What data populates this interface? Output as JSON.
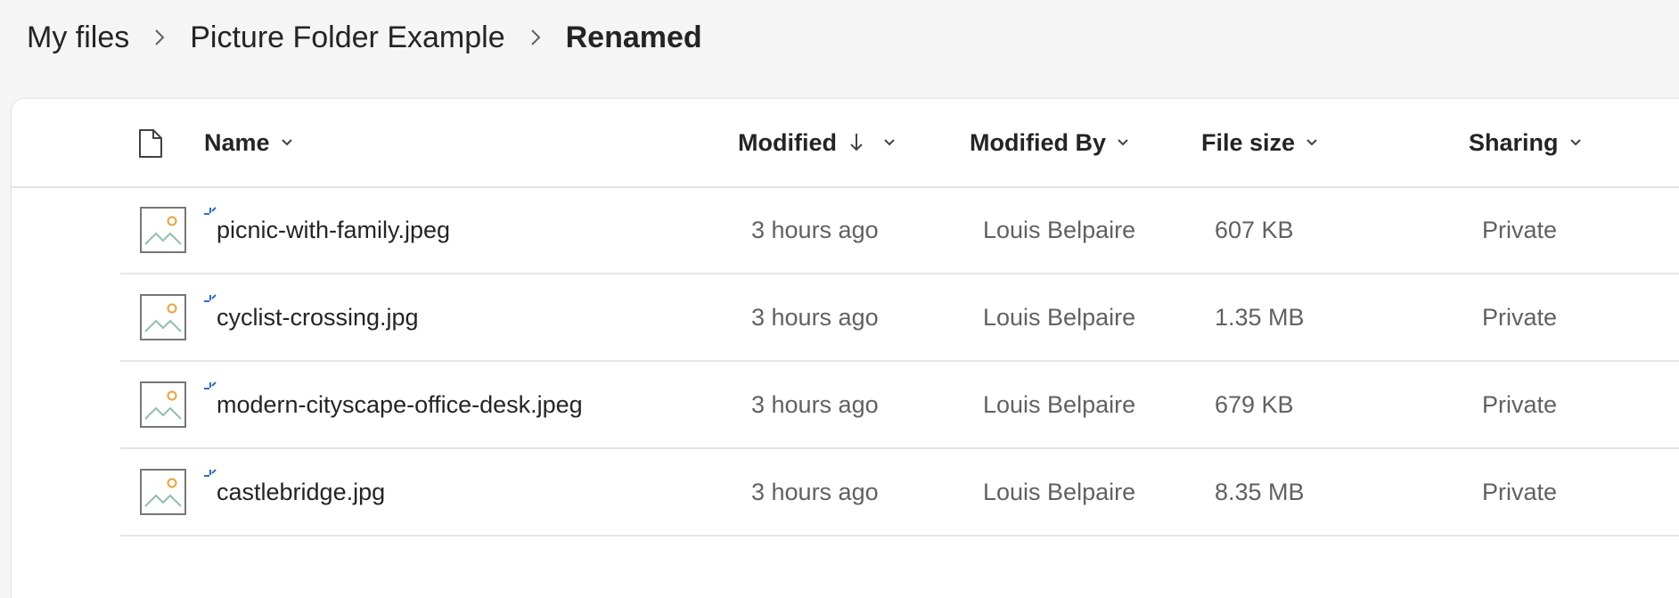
{
  "breadcrumb": {
    "items": [
      {
        "label": "My files",
        "current": false
      },
      {
        "label": "Picture Folder Example",
        "current": false
      },
      {
        "label": "Renamed",
        "current": true
      }
    ]
  },
  "table": {
    "columns": {
      "filetype_icon": "document-icon",
      "name": "Name",
      "modified": "Modified",
      "modified_by": "Modified By",
      "file_size": "File size",
      "sharing": "Sharing"
    },
    "sort": {
      "column": "modified",
      "direction": "descending"
    },
    "rows": [
      {
        "icon": "image-file-icon",
        "new_badge": "sparkle-icon",
        "name": "picnic-with-family.jpeg",
        "modified": "3 hours ago",
        "modified_by": "Louis Belpaire",
        "file_size": "607 KB",
        "sharing": "Private"
      },
      {
        "icon": "image-file-icon",
        "new_badge": "sparkle-icon",
        "name": "cyclist-crossing.jpg",
        "modified": "3 hours ago",
        "modified_by": "Louis Belpaire",
        "file_size": "1.35 MB",
        "sharing": "Private"
      },
      {
        "icon": "image-file-icon",
        "new_badge": "sparkle-icon",
        "name": "modern-cityscape-office-desk.jpeg",
        "modified": "3 hours ago",
        "modified_by": "Louis Belpaire",
        "file_size": "679 KB",
        "sharing": "Private"
      },
      {
        "icon": "image-file-icon",
        "new_badge": "sparkle-icon",
        "name": "castlebridge.jpg",
        "modified": "3 hours ago",
        "modified_by": "Louis Belpaire",
        "file_size": "8.35 MB",
        "sharing": "Private"
      }
    ]
  },
  "colors": {
    "page_background": "#f5f5f5",
    "panel_background": "#ffffff",
    "text_primary": "#242424",
    "text_secondary": "#616161",
    "accent_blue": "#2b6fc0",
    "thumbnail_sun": "#e8a23c",
    "thumbnail_hills": "#8fbfae"
  }
}
